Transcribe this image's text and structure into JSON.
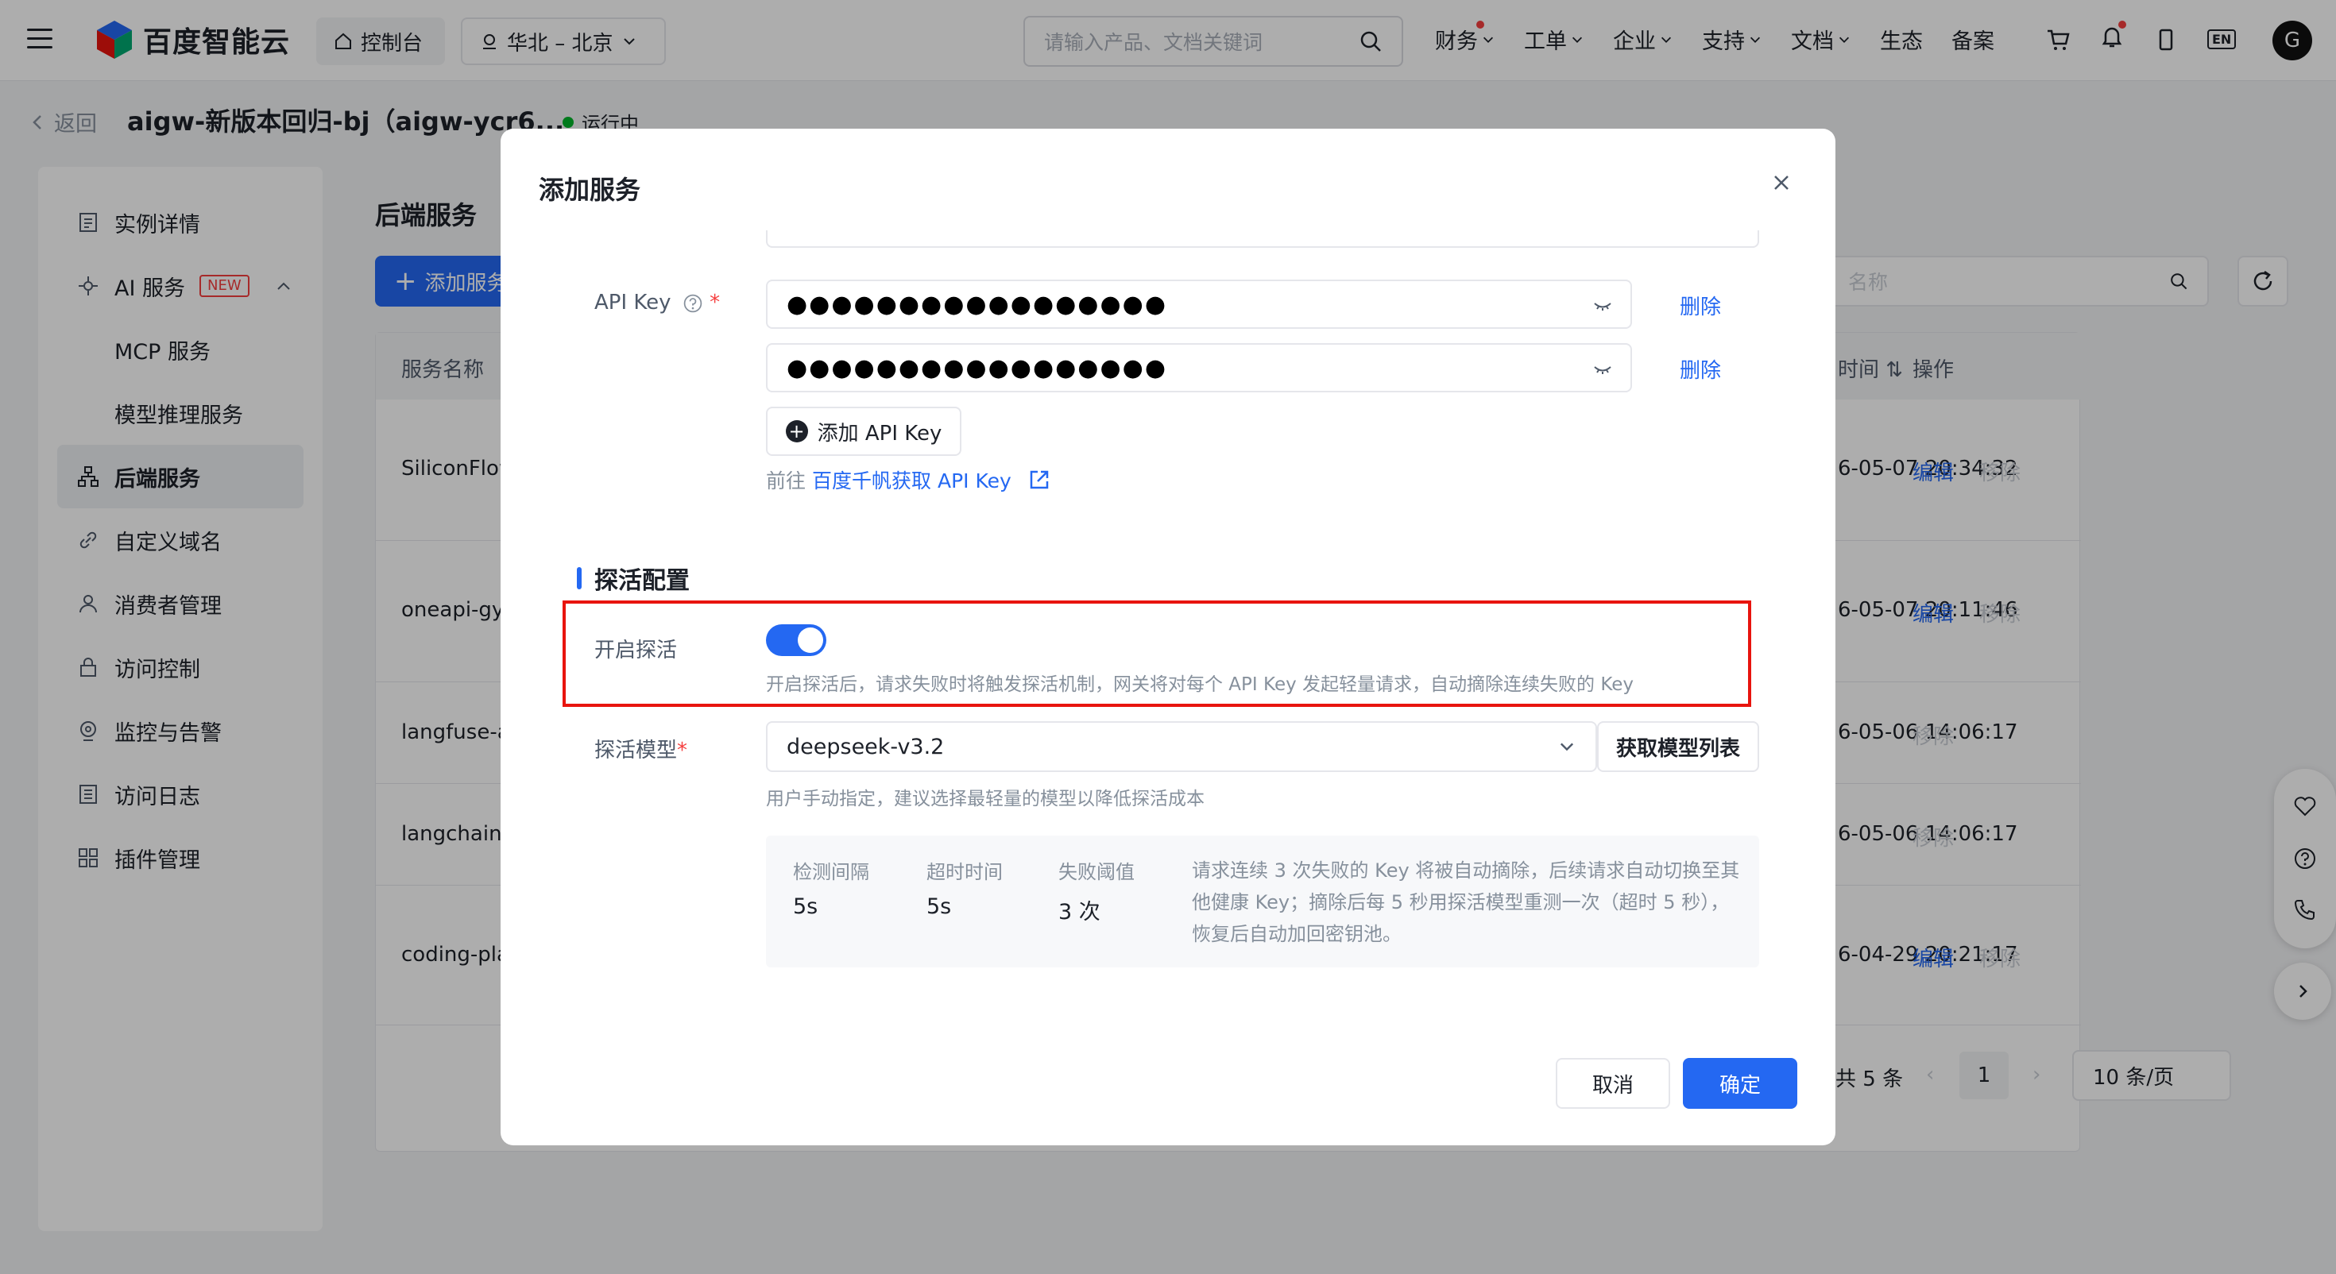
{
  "topbar": {
    "logo_text": "百度智能云",
    "console_label": "控制台",
    "region_label": "华北 – 北京",
    "search_placeholder": "请输入产品、文档关键词",
    "nav": [
      "财务",
      "工单",
      "企业",
      "支持",
      "文档",
      "生态",
      "备案"
    ],
    "lang_label": "EN",
    "avatar_letter": "G"
  },
  "subheader": {
    "back_label": "返回",
    "instance_title": "aigw-新版本回归-bj（aigw-ycr6...",
    "status": "运行中"
  },
  "sidebar": {
    "items": [
      {
        "label": "实例详情"
      },
      {
        "label": "AI 服务",
        "tag": "NEW"
      },
      {
        "label": "MCP 服务"
      },
      {
        "label": "模型推理服务"
      },
      {
        "label": "后端服务"
      },
      {
        "label": "自定义域名"
      },
      {
        "label": "消费者管理"
      },
      {
        "label": "访问控制"
      },
      {
        "label": "监控与告警"
      },
      {
        "label": "访问日志"
      },
      {
        "label": "插件管理"
      }
    ]
  },
  "main": {
    "title": "后端服务",
    "add_button": "添加服务",
    "search_placeholder": "名称",
    "columns": {
      "name": "服务名称",
      "time": "时间",
      "ops": "操作"
    },
    "rows": [
      {
        "name": "SiliconFlow",
        "time": "6-05-07 20:34:32",
        "edit": "编辑",
        "remove": "移除"
      },
      {
        "name": "oneapi-gy",
        "time": "6-05-07 20:11:46",
        "edit": "编辑",
        "remove": "移除"
      },
      {
        "name": "langfuse-a",
        "time": "6-05-06 14:06:17",
        "edit": "",
        "remove": "移除"
      },
      {
        "name": "langchain-",
        "time": "6-05-06 14:06:17",
        "edit": "",
        "remove": "移除"
      },
      {
        "name": "coding-pla",
        "time": "6-04-29 20:21:17",
        "edit": "编辑",
        "remove": "移除"
      }
    ],
    "pager": {
      "total": "共 5 条",
      "page": "1",
      "page_size": "10 条/页"
    }
  },
  "modal": {
    "title": "添加服务",
    "api_key_label": "API Key",
    "keys": [
      "●●●●●●●●●●●●●●●●●",
      "●●●●●●●●●●●●●●●●●"
    ],
    "delete_label": "删除",
    "add_key_label": "添加 API Key",
    "goto_prefix": "前往",
    "goto_link": "百度千帆获取 API Key",
    "section_title": "探活配置",
    "enable_label": "开启探活",
    "enable_on": true,
    "enable_hint": "开启探活后，请求失败时将触发探活机制，网关将对每个 API Key 发起轻量请求，自动摘除连续失败的 Key",
    "model_label": "探活模型",
    "model_value": "deepseek-v3.2",
    "fetch_button": "获取模型列表",
    "model_hint": "用户手动指定，建议选择最轻量的模型以降低探活成本",
    "info": {
      "interval_label": "检测间隔",
      "interval_value": "5s",
      "timeout_label": "超时时间",
      "timeout_value": "5s",
      "threshold_label": "失败阈值",
      "threshold_value": "3 次",
      "description": "请求连续 3 次失败的 Key 将被自动摘除，后续请求自动切换至其他健康 Key；摘除后每 5 秒用探活模型重测一次（超时 5 秒），恢复后自动加回密钥池。"
    },
    "cancel": "取消",
    "confirm": "确定"
  },
  "colors": {
    "primary": "#2468f2",
    "danger": "#f53f3f",
    "highlight": "#e8140e",
    "success": "#00b42a"
  }
}
